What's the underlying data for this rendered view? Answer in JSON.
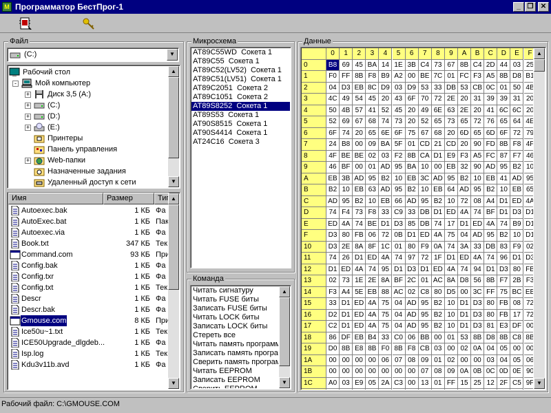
{
  "window": {
    "title": "Программатор БестПрог-1",
    "min": "_",
    "max": "❐",
    "close": "✕"
  },
  "toolbar": {
    "btn1_icon": "chip-write-icon",
    "btn2_icon": "key-icon"
  },
  "file_panel": {
    "label": "Файл",
    "drive": "(C:)",
    "tree": [
      {
        "label": "Рабочий стол",
        "icon": "desktop-icon",
        "indent": 0,
        "expander": ""
      },
      {
        "label": "Мой компьютер",
        "icon": "computer-icon",
        "indent": 1,
        "expander": "-"
      },
      {
        "label": "Диск 3,5 (A:)",
        "icon": "floppy-icon",
        "indent": 2,
        "expander": "+"
      },
      {
        "label": "(C:)",
        "icon": "drive-icon",
        "indent": 2,
        "expander": "+"
      },
      {
        "label": "(D:)",
        "icon": "drive-icon",
        "indent": 2,
        "expander": "+"
      },
      {
        "label": "(E:)",
        "icon": "cdrom-icon",
        "indent": 2,
        "expander": "+"
      },
      {
        "label": "Принтеры",
        "icon": "printer-folder-icon",
        "indent": 2,
        "expander": ""
      },
      {
        "label": "Панель управления",
        "icon": "control-panel-icon",
        "indent": 2,
        "expander": ""
      },
      {
        "label": "Web-папки",
        "icon": "web-folder-icon",
        "indent": 2,
        "expander": "+"
      },
      {
        "label": "Назначенные задания",
        "icon": "tasks-folder-icon",
        "indent": 2,
        "expander": ""
      },
      {
        "label": "Удаленный доступ к сети",
        "icon": "dialup-folder-icon",
        "indent": 2,
        "expander": ""
      }
    ],
    "columns": {
      "name": "Имя",
      "size": "Размер",
      "type": "Тип"
    },
    "files": [
      {
        "name": "Autoexec.bak",
        "size": "1 КБ",
        "type": "Фа"
      },
      {
        "name": "AutoExec.bat",
        "size": "1 КБ",
        "type": "Пак"
      },
      {
        "name": "Autoexec.via",
        "size": "1 КБ",
        "type": "Фа"
      },
      {
        "name": "Book.txt",
        "size": "347 КБ",
        "type": "Тек"
      },
      {
        "name": "Command.com",
        "size": "93 КБ",
        "type": "При"
      },
      {
        "name": "Config.bak",
        "size": "1 КБ",
        "type": "Фа"
      },
      {
        "name": "Config.txr",
        "size": "1 КБ",
        "type": "Фа"
      },
      {
        "name": "Config.txt",
        "size": "1 КБ",
        "type": "Тек"
      },
      {
        "name": "Descr",
        "size": "1 КБ",
        "type": "Фа"
      },
      {
        "name": "Descr.bak",
        "size": "1 КБ",
        "type": "Фа"
      },
      {
        "name": "Gmouse.com",
        "size": "8 КБ",
        "type": "При"
      },
      {
        "name": "Ice50u~1.txt",
        "size": "1 КБ",
        "type": "Тек"
      },
      {
        "name": "ICE50Upgrade_dlgdeb...",
        "size": "1 КБ",
        "type": "Фа"
      },
      {
        "name": "Isp.log",
        "size": "1 КБ",
        "type": "Тек"
      },
      {
        "name": "Kdu3v11b.avd",
        "size": "1 КБ",
        "type": "Фа"
      }
    ],
    "selected_file_index": 10
  },
  "chip_panel": {
    "label": "Микросхема",
    "items": [
      "AT89C55WD  Сокета 1",
      "AT89C55  Сокета 1",
      "AT89C52(LV52)  Сокета 1",
      "AT89C51(LV51)  Сокета 1",
      "AT89C2051  Сокета 2",
      "AT89C1051  Сокета 2",
      "AT89S8252  Сокета 1",
      "AT89S53  Сокета 1",
      "AT90S8515  Сокета 1",
      "AT90S4414  Сокета 1",
      "AT24C16  Сокета 3"
    ],
    "selected_index": 6
  },
  "command_panel": {
    "label": "Команда",
    "items": [
      "Читать сигнатуру",
      "Читать FUSE биты",
      "Записать FUSE биты",
      "Читать LOCK биты",
      "Записать LOCK биты",
      "Стереть все",
      "Читать память программ",
      "Записать память программ",
      "Сверить память программ",
      "Читать EEPROM",
      "Записать EEPROM",
      "Сверить EEPROM"
    ]
  },
  "data_panel": {
    "label": "Данные",
    "col_headers": [
      "0",
      "1",
      "2",
      "3",
      "4",
      "5",
      "6",
      "7",
      "8",
      "9",
      "A",
      "B",
      "C",
      "D",
      "E",
      "F"
    ],
    "rows": [
      {
        "addr": "0",
        "bytes": [
          "B8",
          "69",
          "45",
          "BA",
          "14",
          "1E",
          "3B",
          "C4",
          "73",
          "67",
          "8B",
          "C4",
          "2D",
          "44",
          "03",
          "25"
        ]
      },
      {
        "addr": "1",
        "bytes": [
          "F0",
          "FF",
          "8B",
          "F8",
          "B9",
          "A2",
          "00",
          "BE",
          "7C",
          "01",
          "FC",
          "F3",
          "A5",
          "8B",
          "D8",
          "B1"
        ]
      },
      {
        "addr": "2",
        "bytes": [
          "04",
          "D3",
          "EB",
          "8C",
          "D9",
          "03",
          "D9",
          "53",
          "33",
          "DB",
          "53",
          "CB",
          "0C",
          "01",
          "50",
          "4B"
        ]
      },
      {
        "addr": "3",
        "bytes": [
          "4C",
          "49",
          "54",
          "45",
          "20",
          "43",
          "6F",
          "70",
          "72",
          "2E",
          "20",
          "31",
          "39",
          "39",
          "31",
          "20"
        ]
      },
      {
        "addr": "4",
        "bytes": [
          "50",
          "4B",
          "57",
          "41",
          "52",
          "45",
          "20",
          "49",
          "6E",
          "63",
          "2E",
          "20",
          "41",
          "6C",
          "6C",
          "20"
        ]
      },
      {
        "addr": "5",
        "bytes": [
          "52",
          "69",
          "67",
          "68",
          "74",
          "73",
          "20",
          "52",
          "65",
          "73",
          "65",
          "72",
          "76",
          "65",
          "64",
          "4E"
        ]
      },
      {
        "addr": "6",
        "bytes": [
          "6F",
          "74",
          "20",
          "65",
          "6E",
          "6F",
          "75",
          "67",
          "68",
          "20",
          "6D",
          "65",
          "6D",
          "6F",
          "72",
          "79"
        ]
      },
      {
        "addr": "7",
        "bytes": [
          "24",
          "B8",
          "00",
          "09",
          "BA",
          "5F",
          "01",
          "CD",
          "21",
          "CD",
          "20",
          "90",
          "FD",
          "8B",
          "F8",
          "4F"
        ]
      },
      {
        "addr": "8",
        "bytes": [
          "4F",
          "BE",
          "BE",
          "02",
          "03",
          "F2",
          "8B",
          "CA",
          "D1",
          "E9",
          "F3",
          "A5",
          "FC",
          "87",
          "F7",
          "46"
        ]
      },
      {
        "addr": "9",
        "bytes": [
          "46",
          "BF",
          "00",
          "01",
          "AD",
          "95",
          "BA",
          "10",
          "00",
          "EB",
          "32",
          "90",
          "AD",
          "95",
          "B2",
          "10"
        ]
      },
      {
        "addr": "A",
        "bytes": [
          "EB",
          "3B",
          "AD",
          "95",
          "B2",
          "10",
          "EB",
          "3C",
          "AD",
          "95",
          "B2",
          "10",
          "EB",
          "41",
          "AD",
          "95"
        ]
      },
      {
        "addr": "B",
        "bytes": [
          "B2",
          "10",
          "EB",
          "63",
          "AD",
          "95",
          "B2",
          "10",
          "EB",
          "64",
          "AD",
          "95",
          "B2",
          "10",
          "EB",
          "65"
        ]
      },
      {
        "addr": "C",
        "bytes": [
          "AD",
          "95",
          "B2",
          "10",
          "EB",
          "66",
          "AD",
          "95",
          "B2",
          "10",
          "72",
          "08",
          "A4",
          "D1",
          "ED",
          "4A"
        ]
      },
      {
        "addr": "D",
        "bytes": [
          "74",
          "F4",
          "73",
          "F8",
          "33",
          "C9",
          "33",
          "DB",
          "D1",
          "ED",
          "4A",
          "74",
          "BF",
          "D1",
          "D3",
          "D1"
        ]
      },
      {
        "addr": "E",
        "bytes": [
          "ED",
          "4A",
          "74",
          "BE",
          "D1",
          "D3",
          "85",
          "DB",
          "74",
          "17",
          "D1",
          "ED",
          "4A",
          "74",
          "B9",
          "D1"
        ]
      },
      {
        "addr": "F",
        "bytes": [
          "D3",
          "80",
          "FB",
          "06",
          "72",
          "0B",
          "D1",
          "ED",
          "4A",
          "75",
          "04",
          "AD",
          "95",
          "B2",
          "10",
          "D1"
        ]
      },
      {
        "addr": "10",
        "bytes": [
          "D3",
          "2E",
          "8A",
          "8F",
          "1C",
          "01",
          "80",
          "F9",
          "0A",
          "74",
          "3A",
          "33",
          "DB",
          "83",
          "F9",
          "02"
        ]
      },
      {
        "addr": "11",
        "bytes": [
          "74",
          "26",
          "D1",
          "ED",
          "4A",
          "74",
          "97",
          "72",
          "1F",
          "D1",
          "ED",
          "4A",
          "74",
          "96",
          "D1",
          "D3"
        ]
      },
      {
        "addr": "12",
        "bytes": [
          "D1",
          "ED",
          "4A",
          "74",
          "95",
          "D1",
          "D3",
          "D1",
          "ED",
          "4A",
          "74",
          "94",
          "D1",
          "D3",
          "80",
          "FB"
        ]
      },
      {
        "addr": "13",
        "bytes": [
          "02",
          "73",
          "1E",
          "2E",
          "8A",
          "BF",
          "2C",
          "01",
          "AC",
          "8A",
          "D8",
          "56",
          "8B",
          "F7",
          "2B",
          "F3"
        ]
      },
      {
        "addr": "14",
        "bytes": [
          "F3",
          "A4",
          "5E",
          "EB",
          "88",
          "AC",
          "02",
          "C8",
          "80",
          "D5",
          "00",
          "3C",
          "FF",
          "75",
          "BC",
          "EB"
        ]
      },
      {
        "addr": "15",
        "bytes": [
          "33",
          "D1",
          "ED",
          "4A",
          "75",
          "04",
          "AD",
          "95",
          "B2",
          "10",
          "D1",
          "D3",
          "80",
          "FB",
          "08",
          "72"
        ]
      },
      {
        "addr": "16",
        "bytes": [
          "D2",
          "D1",
          "ED",
          "4A",
          "75",
          "04",
          "AD",
          "95",
          "B2",
          "10",
          "D1",
          "D3",
          "80",
          "FB",
          "17",
          "72"
        ]
      },
      {
        "addr": "17",
        "bytes": [
          "C2",
          "D1",
          "ED",
          "4A",
          "75",
          "04",
          "AD",
          "95",
          "B2",
          "10",
          "D1",
          "D3",
          "81",
          "E3",
          "DF",
          "00"
        ]
      },
      {
        "addr": "18",
        "bytes": [
          "86",
          "DF",
          "EB",
          "B4",
          "33",
          "C0",
          "06",
          "BB",
          "00",
          "01",
          "53",
          "8B",
          "D8",
          "8B",
          "C8",
          "8B"
        ]
      },
      {
        "addr": "19",
        "bytes": [
          "D0",
          "8B",
          "E8",
          "8B",
          "F0",
          "8B",
          "F8",
          "CB",
          "03",
          "00",
          "02",
          "0A",
          "04",
          "05",
          "00",
          "00"
        ]
      },
      {
        "addr": "1A",
        "bytes": [
          "00",
          "00",
          "00",
          "00",
          "06",
          "07",
          "08",
          "09",
          "01",
          "02",
          "00",
          "00",
          "03",
          "04",
          "05",
          "06"
        ]
      },
      {
        "addr": "1B",
        "bytes": [
          "00",
          "00",
          "00",
          "00",
          "00",
          "00",
          "00",
          "07",
          "08",
          "09",
          "0A",
          "0B",
          "0C",
          "0D",
          "0E",
          "90"
        ]
      },
      {
        "addr": "1C",
        "bytes": [
          "A0",
          "03",
          "E9",
          "05",
          "2A",
          "C3",
          "00",
          "13",
          "01",
          "FF",
          "15",
          "25",
          "12",
          "2F",
          "C5",
          "9F"
        ]
      },
      {
        "addr": "1D",
        "bytes": [
          "12",
          "04",
          "3A",
          "12",
          "12",
          "1D",
          "48",
          "01",
          "14",
          "06",
          "F8",
          "03",
          "01",
          "0C",
          "10",
          "31"
        ]
      }
    ],
    "selected_cell": [
      0,
      0
    ]
  },
  "status": {
    "text": "Рабочий файл: C:\\GMOUSE.COM"
  }
}
